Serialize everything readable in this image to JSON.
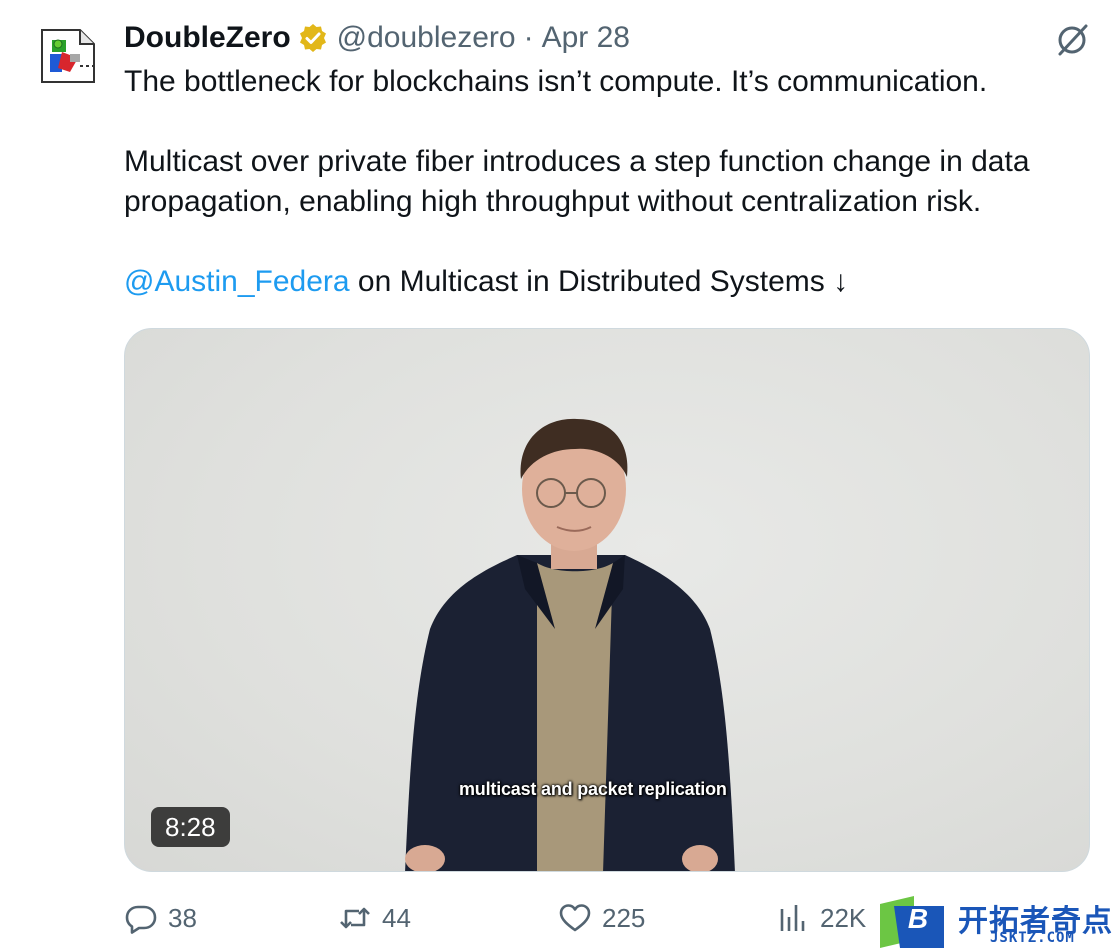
{
  "tweet": {
    "author_name": "DoubleZero",
    "handle": "@doublezero",
    "separator": "·",
    "date": "Apr 28",
    "text_line1": "The bottleneck for blockchains isn’t compute. It’s communication.",
    "text_para2": "Multicast over private fiber introduces a step function change in data propagation, enabling high throughput without centralization risk.",
    "mention": "@Austin_Federa",
    "text_after_mention": " on Multicast in Distributed Systems ↓"
  },
  "media": {
    "caption": "multicast and packet replication",
    "duration": "8:28"
  },
  "actions": {
    "replies": "38",
    "reposts": "44",
    "likes": "225",
    "views": "22K"
  },
  "watermark": {
    "logo_letter": "B",
    "chinese": "开拓者奇点",
    "domain": "JSKTZ.COM"
  },
  "colors": {
    "accent": "#1d9bf0",
    "secondary_text": "#536471",
    "verified_badge": "#e2b719",
    "watermark_blue": "#1a56b8",
    "watermark_green": "#6cc644"
  },
  "icons": {
    "avatar": "broken-image-icon",
    "verified": "verified-badge-icon",
    "grok": "grok-icon",
    "reply": "reply-icon",
    "repost": "repost-icon",
    "like": "heart-icon",
    "views": "views-chart-icon"
  }
}
